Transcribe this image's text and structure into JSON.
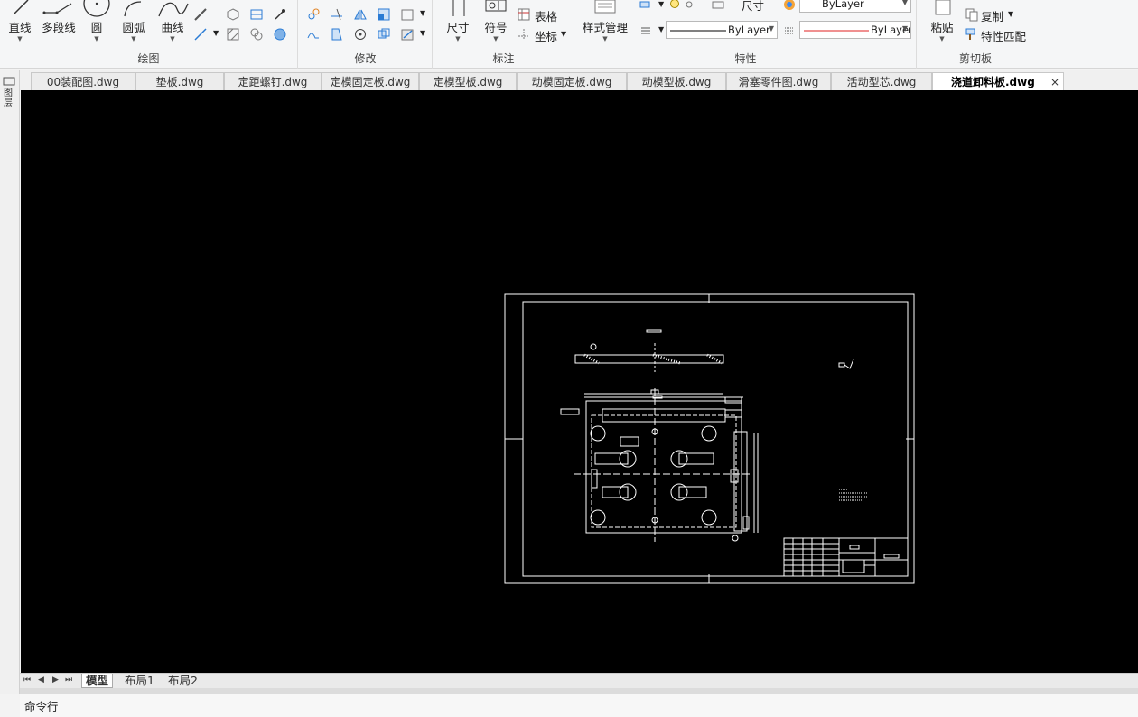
{
  "ribbon": {
    "draw": {
      "title": "绘图",
      "tools": [
        {
          "name": "line",
          "label": "直线"
        },
        {
          "name": "polyline",
          "label": "多段线"
        },
        {
          "name": "circle",
          "label": "圆"
        },
        {
          "name": "arc",
          "label": "圆弧"
        },
        {
          "name": "curve",
          "label": "曲线"
        }
      ]
    },
    "modify": {
      "title": "修改"
    },
    "annotation": {
      "title": "标注",
      "dimension": "尺寸",
      "symbol": "符号",
      "table": "表格",
      "coordinate": "坐标"
    },
    "properties": {
      "title": "特性",
      "style_manager": "样式管理",
      "layer_value": "尺寸",
      "color_value": "ByLayer",
      "linetype_value": "ByLayer",
      "lineweight_value": "ByLayer"
    },
    "clipboard": {
      "title": "剪切板",
      "paste": "粘贴",
      "copy": "复制",
      "match_properties": "特性匹配"
    }
  },
  "left_panel": {
    "label": "图层"
  },
  "file_tabs": [
    {
      "label": "00装配图.dwg"
    },
    {
      "label": "垫板.dwg"
    },
    {
      "label": "定距螺钉.dwg"
    },
    {
      "label": "定模固定板.dwg"
    },
    {
      "label": "定模型板.dwg"
    },
    {
      "label": "动模固定板.dwg"
    },
    {
      "label": "动模型板.dwg"
    },
    {
      "label": "滑塞零件图.dwg"
    },
    {
      "label": "活动型芯.dwg"
    },
    {
      "label": "浇道卸料板.dwg",
      "active": true
    }
  ],
  "tab_close": "×",
  "layout_tabs": [
    {
      "label": "模型",
      "active": true
    },
    {
      "label": "布局1"
    },
    {
      "label": "布局2"
    }
  ],
  "command_line": {
    "label": "命令行"
  },
  "colors": {
    "canvas_bg": "#000000",
    "drawing_lines": "#ffffff",
    "layer_red": "#e02020"
  }
}
